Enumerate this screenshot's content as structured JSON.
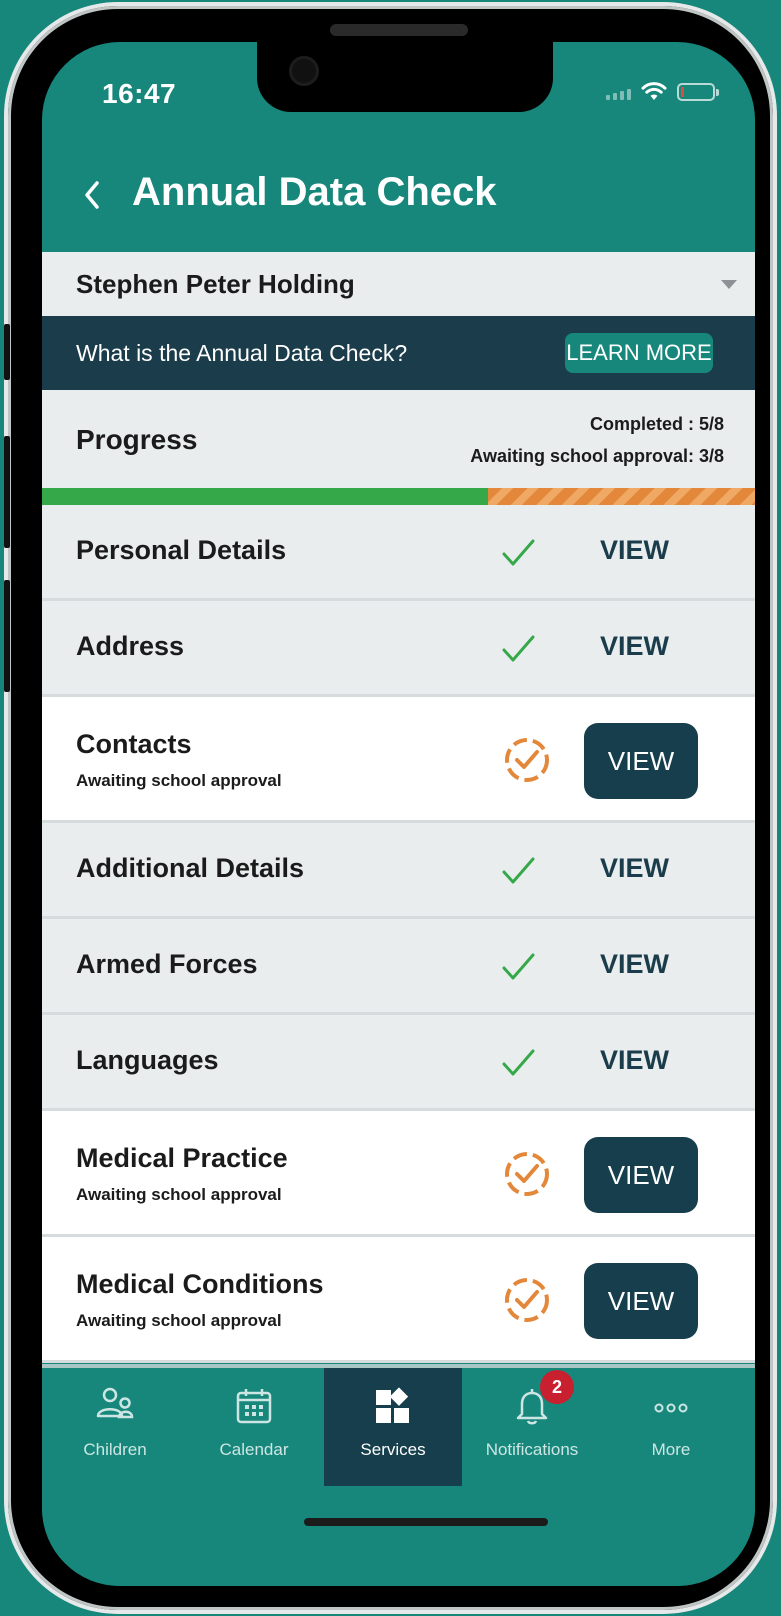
{
  "status_bar": {
    "time": "16:47"
  },
  "header": {
    "title": "Annual Data Check"
  },
  "child_selector": {
    "name": "Stephen Peter Holding"
  },
  "info_bar": {
    "question": "What is the Annual Data Check?",
    "learn_more": "LEARN MORE"
  },
  "progress": {
    "label": "Progress",
    "completed": "Completed : 5/8",
    "awaiting": "Awaiting school approval: 3/8",
    "completed_fraction": 0.625,
    "colors": {
      "completed": "#35a84a",
      "awaiting": "#e3873a"
    }
  },
  "sections": [
    {
      "title": "Personal Details",
      "status": "complete",
      "subtitle": "",
      "view": "VIEW"
    },
    {
      "title": "Address",
      "status": "complete",
      "subtitle": "",
      "view": "VIEW"
    },
    {
      "title": "Contacts",
      "status": "awaiting",
      "subtitle": "Awaiting school approval",
      "view": "VIEW"
    },
    {
      "title": "Additional Details",
      "status": "complete",
      "subtitle": "",
      "view": "VIEW"
    },
    {
      "title": "Armed Forces",
      "status": "complete",
      "subtitle": "",
      "view": "VIEW"
    },
    {
      "title": "Languages",
      "status": "complete",
      "subtitle": "",
      "view": "VIEW"
    },
    {
      "title": "Medical Practice",
      "status": "awaiting",
      "subtitle": "Awaiting school approval",
      "view": "VIEW"
    },
    {
      "title": "Medical Conditions",
      "status": "awaiting",
      "subtitle": "Awaiting school approval",
      "view": "VIEW"
    }
  ],
  "tabbar": {
    "items": [
      {
        "label": "Children",
        "icon": "children-icon"
      },
      {
        "label": "Calendar",
        "icon": "calendar-icon"
      },
      {
        "label": "Services",
        "icon": "services-icon",
        "active": true
      },
      {
        "label": "Notifications",
        "icon": "bell-icon",
        "badge": "2"
      },
      {
        "label": "More",
        "icon": "more-icon"
      }
    ]
  },
  "colors": {
    "brand_teal": "#17877c",
    "dark_navy": "#163e4c",
    "check_green": "#35a84a",
    "pending_orange": "#e3873a",
    "badge_red": "#c8202e"
  }
}
